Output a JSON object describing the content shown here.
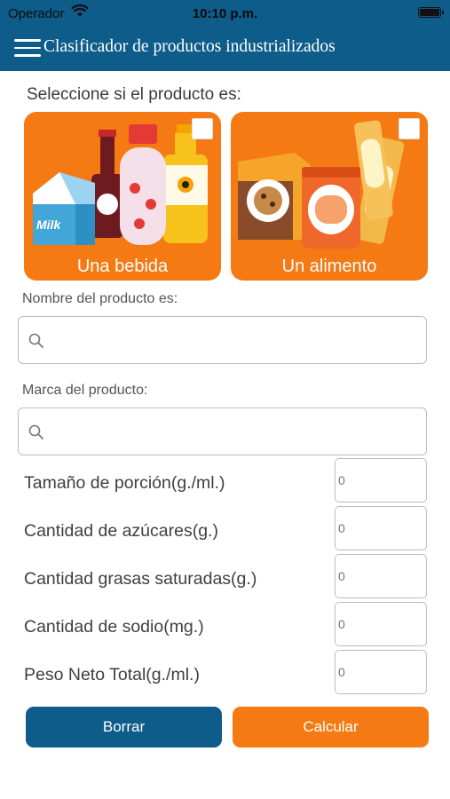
{
  "status_bar": {
    "carrier": "Operador",
    "time": "10:10 p.m."
  },
  "nav": {
    "title": "Clasificador de productos industrializados",
    "menu_icon": "hamburger-menu-icon"
  },
  "prompt": "Seleccione si el producto es:",
  "product_types": [
    {
      "label": "Una bebida",
      "milk_text": "Milk",
      "checked": false
    },
    {
      "label": "Un alimento",
      "checked": false
    }
  ],
  "fields": {
    "name_label": "Nombre del producto es:",
    "brand_label": "Marca del producto:",
    "search_icon": "search-icon"
  },
  "nutrition": [
    {
      "label": "Tamaño de porción(g./ml.)",
      "placeholder": "0"
    },
    {
      "label": "Cantidad de azúcares(g.)",
      "placeholder": "0"
    },
    {
      "label": "Cantidad grasas saturadas(g.)",
      "placeholder": "0"
    },
    {
      "label": "Cantidad de sodio(mg.)",
      "placeholder": "0"
    },
    {
      "label": "Peso Neto Total(g./ml.)",
      "placeholder": "0"
    }
  ],
  "buttons": {
    "clear": "Borrar",
    "calculate": "Calcular"
  },
  "colors": {
    "primary_blue": "#0e5c8a",
    "accent_orange": "#f57a14"
  }
}
